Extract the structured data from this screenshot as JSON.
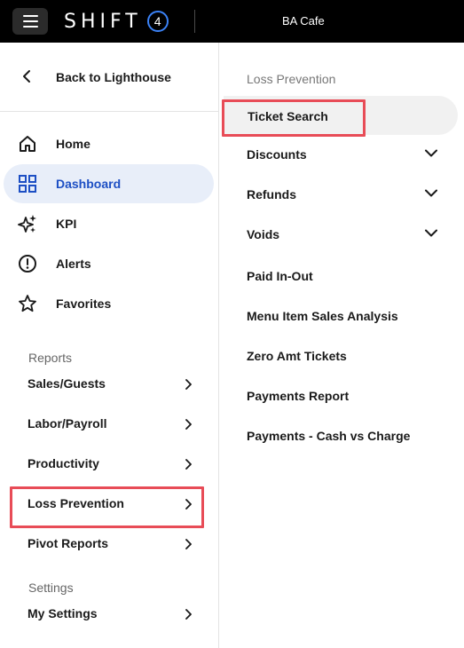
{
  "header": {
    "logo_text": "SHIFT",
    "logo_badge": "4",
    "location": "BA Cafe"
  },
  "left_nav": {
    "back_label": "Back to Lighthouse",
    "items": [
      {
        "label": "Home",
        "icon": "home-icon"
      },
      {
        "label": "Dashboard",
        "icon": "dashboard-grid-icon",
        "active": true
      },
      {
        "label": "KPI",
        "icon": "sparkle-icon"
      },
      {
        "label": "Alerts",
        "icon": "alert-circle-icon"
      },
      {
        "label": "Favorites",
        "icon": "star-icon"
      }
    ],
    "reports_title": "Reports",
    "reports": [
      {
        "label": "Sales/Guests"
      },
      {
        "label": "Labor/Payroll"
      },
      {
        "label": "Productivity"
      },
      {
        "label": "Loss Prevention",
        "highlighted": true
      },
      {
        "label": "Pivot Reports"
      }
    ],
    "settings_title": "Settings",
    "settings": [
      {
        "label": "My Settings"
      }
    ]
  },
  "submenu": {
    "title": "Loss Prevention",
    "items": [
      {
        "label": "Ticket Search",
        "highlighted": true,
        "expandable": false
      },
      {
        "label": "Discounts",
        "expandable": true
      },
      {
        "label": "Refunds",
        "expandable": true
      },
      {
        "label": "Voids",
        "expandable": true
      },
      {
        "label": "Paid In-Out",
        "expandable": false
      },
      {
        "label": "Menu Item Sales Analysis",
        "expandable": false
      },
      {
        "label": "Zero Amt Tickets",
        "expandable": false
      },
      {
        "label": "Payments Report",
        "expandable": false
      },
      {
        "label": "Payments - Cash vs Charge",
        "expandable": false
      }
    ]
  },
  "colors": {
    "topbar": "#000000",
    "accent": "#1d4fc4",
    "active_bg": "#e8eef9",
    "highlight": "#e84c57"
  }
}
